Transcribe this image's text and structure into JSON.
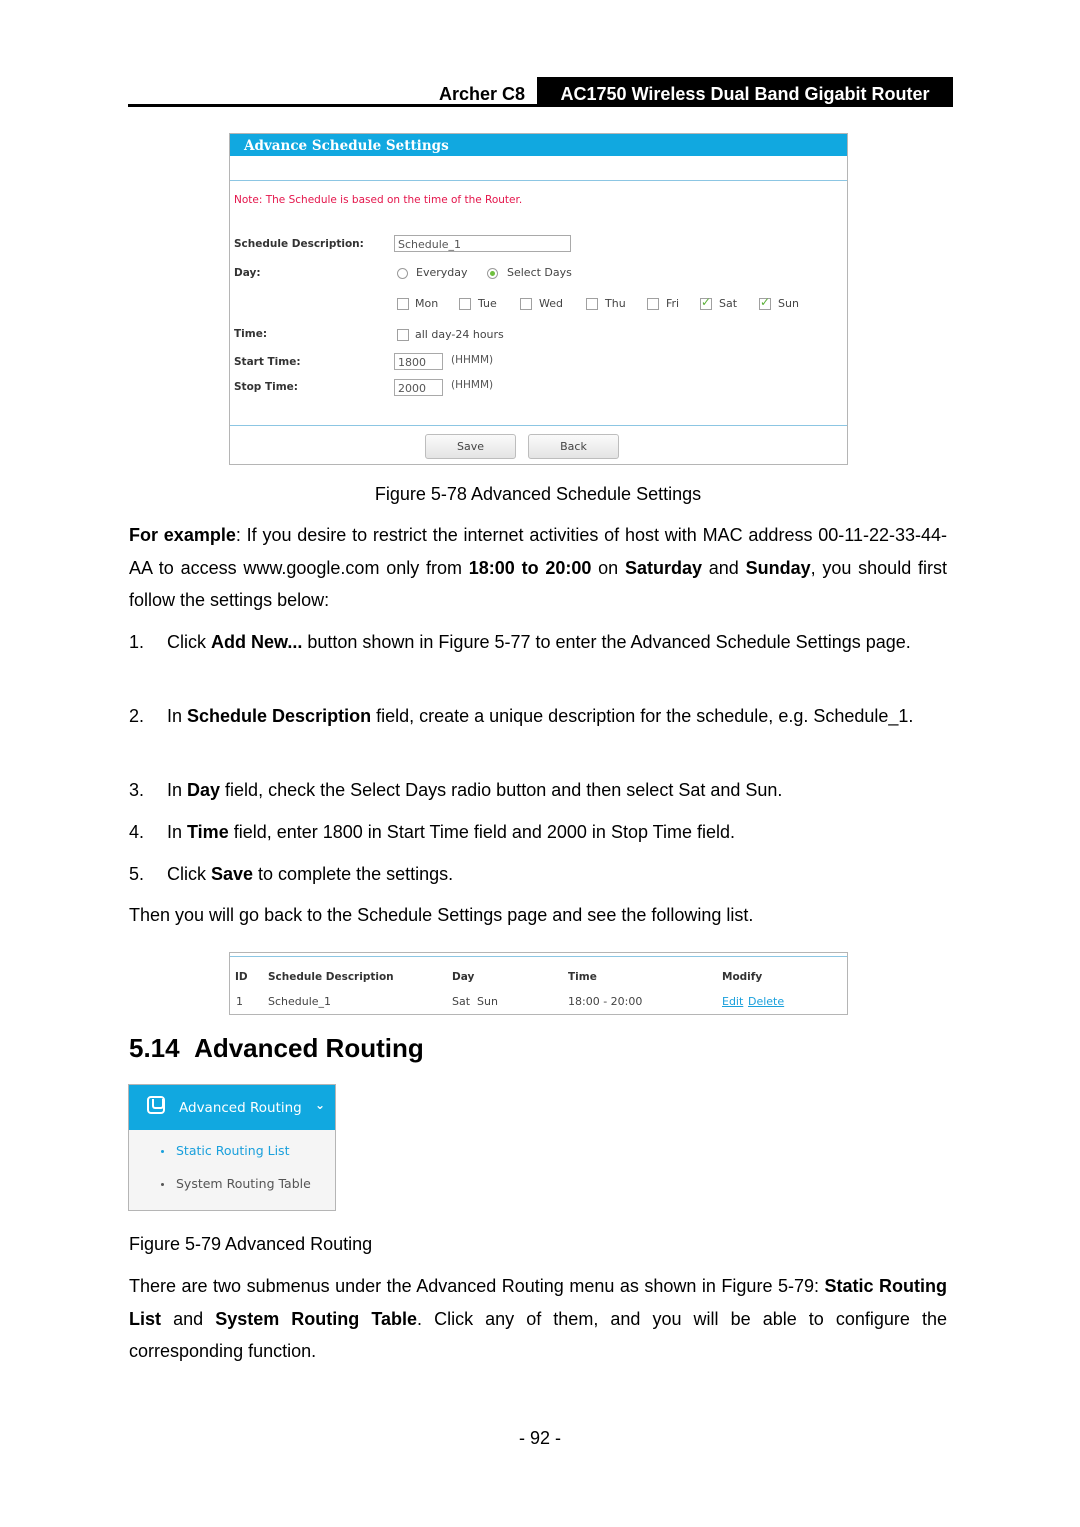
{
  "header": {
    "model": "Archer C8",
    "product": "AC1750 Wireless Dual Band Gigabit Router"
  },
  "figure78": {
    "title": "Advance Schedule Settings",
    "note": "Note: The Schedule is based on the time of the Router.",
    "schedule_description_label": "Schedule Description:",
    "schedule_description_value": "Schedule_1",
    "day_label": "Day:",
    "day_options": [
      {
        "label": "Everyday",
        "selected": false
      },
      {
        "label": "Select Days",
        "selected": true
      }
    ],
    "days": [
      {
        "label": "Mon",
        "checked": false
      },
      {
        "label": "Tue",
        "checked": false
      },
      {
        "label": "Wed",
        "checked": false
      },
      {
        "label": "Thu",
        "checked": false
      },
      {
        "label": "Fri",
        "checked": false
      },
      {
        "label": "Sat",
        "checked": true
      },
      {
        "label": "Sun",
        "checked": true
      }
    ],
    "time_label": "Time:",
    "all_day_label": "all day-24 hours",
    "all_day_checked": false,
    "start_time_label": "Start Time:",
    "start_time_value": "1800",
    "stop_time_label": "Stop Time:",
    "stop_time_value": "2000",
    "format_hint": "(HHMM)",
    "save_label": "Save",
    "back_label": "Back",
    "caption": "Figure 5-78 Advanced Schedule Settings"
  },
  "example": {
    "lead": "For example",
    "p1": ": If you desire to restrict the internet activities of host with MAC address 00-11-22-33-44-AA to access www.google.com only from ",
    "time_range": "18:00 to 20:00",
    "p2": " on ",
    "day1": "Saturday",
    "p3": " and ",
    "day2": "Sunday",
    "p4": ", you should first follow the settings below:"
  },
  "steps": [
    {
      "num": "1.",
      "pre": "Click ",
      "bold": "Add New...",
      "post": " button shown in Figure 5-77 to enter the Advanced Schedule Settings page."
    },
    {
      "num": "2.",
      "pre": "In ",
      "bold": "Schedule Description",
      "post": " field, create a unique description for the schedule, e.g. Schedule_1."
    },
    {
      "num": "3.",
      "pre": "In ",
      "bold": "Day",
      "post": " field, check the Select Days radio button and then select Sat and Sun."
    },
    {
      "num": "4.",
      "pre": "In ",
      "bold": "Time",
      "post": " field, enter 1800 in Start Time field and 2000 in Stop Time field."
    },
    {
      "num": "5.",
      "pre": "Click ",
      "bold": "Save",
      "post": " to complete the settings."
    }
  ],
  "then_text": "Then you will go back to the Schedule Settings page and see the following list.",
  "schedule_table": {
    "headers": [
      "ID",
      "Schedule Description",
      "Day",
      "Time",
      "Modify"
    ],
    "rows": [
      {
        "id": "1",
        "description": "Schedule_1",
        "day": "Sat  Sun",
        "time": "18:00 - 20:00",
        "edit": "Edit",
        "delete": "Delete"
      }
    ]
  },
  "section": {
    "number": "5.14",
    "title": "Advanced Routing"
  },
  "figure79": {
    "menu_title": "Advanced Routing",
    "items": [
      {
        "label": "Static Routing List",
        "active": true
      },
      {
        "label": "System Routing Table",
        "active": false
      }
    ],
    "caption": "Figure 5-79 Advanced Routing"
  },
  "closing": {
    "p1": "There are two submenus under the Advanced Routing menu as shown in Figure 5-79: ",
    "b1": "Static Routing List",
    "p2": " and ",
    "b2": "System Routing Table",
    "p3": ". Click any of them, and you will be able to configure the corresponding function."
  },
  "page_number": "- 92 -",
  "colors": {
    "accent": "#11a8e0",
    "note_red": "#e4154b",
    "check_green": "#5cb03a",
    "link_blue": "#1aa0dc"
  }
}
